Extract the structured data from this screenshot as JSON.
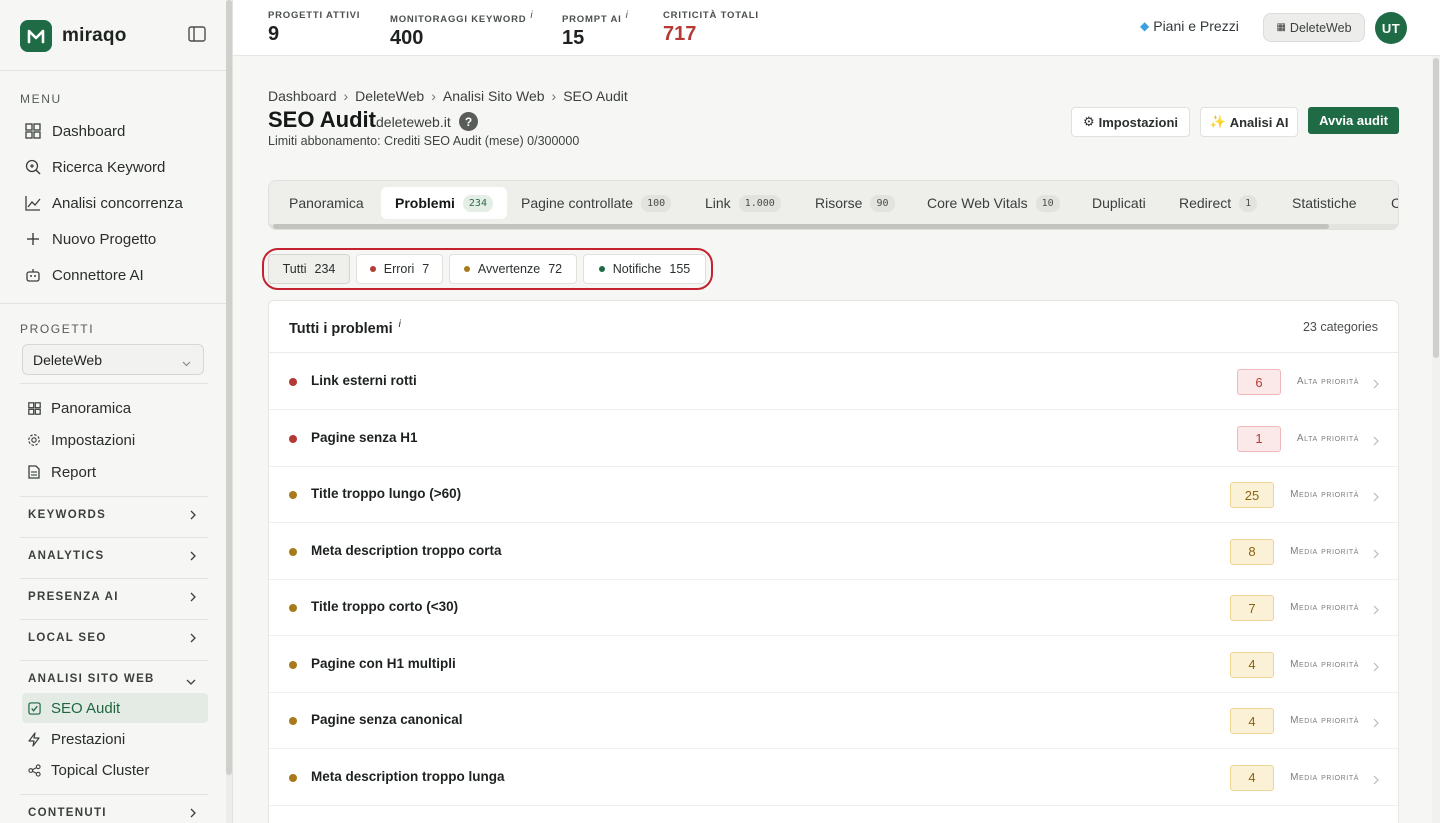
{
  "brand": {
    "name": "miraqo"
  },
  "sidebar": {
    "menu_label": "MENU",
    "menu": [
      {
        "label": "Dashboard",
        "icon": "grid-icon"
      },
      {
        "label": "Ricerca Keyword",
        "icon": "search-icon"
      },
      {
        "label": "Analisi concorrenza",
        "icon": "chart-line-icon"
      },
      {
        "label": "Nuovo Progetto",
        "icon": "plus-icon"
      },
      {
        "label": "Connettore AI",
        "icon": "robot-icon"
      }
    ],
    "projects_label": "PROGETTI",
    "project_select": "DeleteWeb",
    "project_items": [
      {
        "label": "Panoramica",
        "icon": "grid-icon"
      },
      {
        "label": "Impostazioni",
        "icon": "gear-icon"
      },
      {
        "label": "Report",
        "icon": "document-icon"
      }
    ],
    "groups": [
      {
        "label": "KEYWORDS"
      },
      {
        "label": "ANALYTICS"
      },
      {
        "label": "PRESENZA AI"
      },
      {
        "label": "LOCAL SEO"
      },
      {
        "label": "ANALISI SITO WEB"
      }
    ],
    "site_items": [
      {
        "label": "SEO Audit",
        "icon": "check-square-icon",
        "active": true
      },
      {
        "label": "Prestazioni",
        "icon": "lightning-icon"
      },
      {
        "label": "Topical Cluster",
        "icon": "share-nodes-icon"
      }
    ],
    "last_group": "CONTENUTI"
  },
  "topbar": {
    "stats": [
      {
        "label": "PROGETTI ATTIVI",
        "value": "9",
        "info": ""
      },
      {
        "label": "MONITORAGGI KEYWORD",
        "value": "400",
        "info": "i"
      },
      {
        "label": "PROMPT AI",
        "value": "15",
        "info": "i"
      },
      {
        "label": "CRITICITÀ TOTALI",
        "value": "717",
        "info": ""
      }
    ],
    "plans_label": "Piani e Prezzi",
    "workspace": "DeleteWeb",
    "avatar_initials": "UT"
  },
  "page": {
    "breadcrumb": [
      "Dashboard",
      "DeleteWeb",
      "Analisi Sito Web",
      "SEO Audit"
    ],
    "title": "SEO Audit",
    "domain": "deleteweb.it",
    "help": "?",
    "limits": "Limiti abbonamento: Crediti SEO Audit (mese) 0/300000",
    "actions": {
      "settings": "Impostazioni",
      "ai": "Analisi AI",
      "start": "Avvia audit"
    }
  },
  "tabs": [
    {
      "label": "Panoramica",
      "count": ""
    },
    {
      "label": "Problemi",
      "count": "234",
      "active": true
    },
    {
      "label": "Pagine controllate",
      "count": "100"
    },
    {
      "label": "Link",
      "count": "1.000"
    },
    {
      "label": "Risorse",
      "count": "90"
    },
    {
      "label": "Core Web Vitals",
      "count": "10"
    },
    {
      "label": "Duplicati",
      "count": ""
    },
    {
      "label": "Redirect",
      "count": "1"
    },
    {
      "label": "Statistiche",
      "count": ""
    },
    {
      "label": "C",
      "count": ""
    }
  ],
  "filters": [
    {
      "label": "Tutti",
      "count": "234",
      "active": true
    },
    {
      "label": "Errori",
      "count": "7",
      "dot": "#b53a36"
    },
    {
      "label": "Avvertenze",
      "count": "72",
      "dot": "#a87a1c"
    },
    {
      "label": "Notifiche",
      "count": "155",
      "dot": "#1f6b45"
    }
  ],
  "issues_panel": {
    "title": "Tutti i problemi",
    "info": "i",
    "meta": "23 categories",
    "rows": [
      {
        "name": "Link esterni rotti",
        "count": "6",
        "priority": "Alta priorità",
        "level": "high"
      },
      {
        "name": "Pagine senza H1",
        "count": "1",
        "priority": "Alta priorità",
        "level": "high"
      },
      {
        "name": "Title troppo lungo (>60)",
        "count": "25",
        "priority": "Media priorità",
        "level": "med"
      },
      {
        "name": "Meta description troppo corta",
        "count": "8",
        "priority": "Media priorità",
        "level": "med"
      },
      {
        "name": "Title troppo corto (<30)",
        "count": "7",
        "priority": "Media priorità",
        "level": "med"
      },
      {
        "name": "Pagine con H1 multipli",
        "count": "4",
        "priority": "Media priorità",
        "level": "med"
      },
      {
        "name": "Pagine senza canonical",
        "count": "4",
        "priority": "Media priorità",
        "level": "med"
      },
      {
        "name": "Meta description troppo lunga",
        "count": "4",
        "priority": "Media priorità",
        "level": "med"
      }
    ]
  },
  "colors": {
    "brand": "#1f6b45",
    "error": "#b53a36",
    "warning": "#a87a1c",
    "highlight": "#c3232f"
  }
}
